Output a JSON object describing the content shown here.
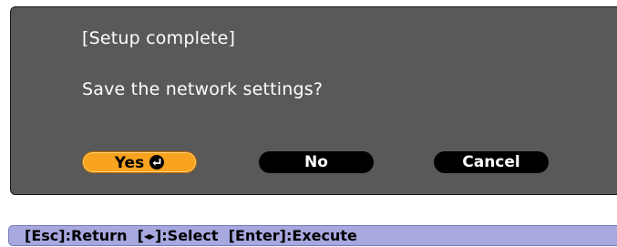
{
  "dialog": {
    "title": "[Setup complete]",
    "question": "Save the network settings?"
  },
  "buttons": {
    "yes": {
      "label": "Yes",
      "icon": "enter-icon"
    },
    "no": {
      "label": "No"
    },
    "cancel": {
      "label": "Cancel"
    }
  },
  "footer": {
    "esc_key": "[Esc]",
    "esc_action": ":Return",
    "select_key_open": "[",
    "select_key_icon": "◂▸",
    "select_key_close": "]",
    "select_action": ":Select",
    "enter_key": "[Enter]",
    "enter_action": ":Execute"
  },
  "colors": {
    "dialog_bg": "#595959",
    "selected_button": "#f7a320",
    "button_bg": "#000000",
    "footer_bg": "#a8a8e0"
  }
}
